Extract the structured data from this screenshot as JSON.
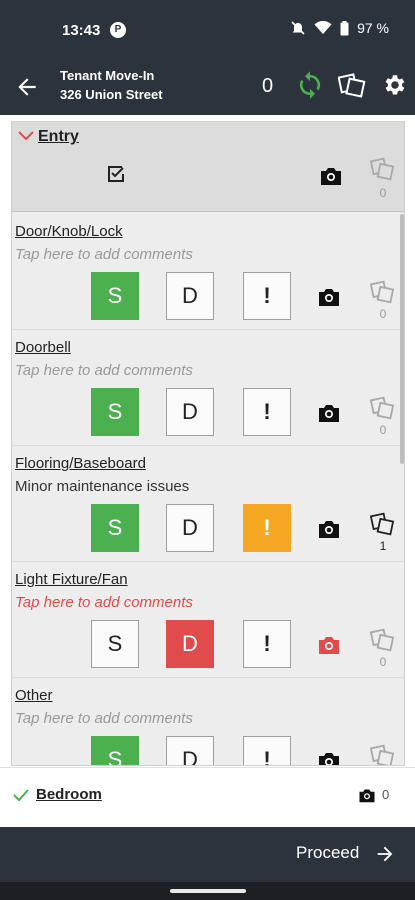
{
  "status": {
    "time": "13:43",
    "battery": "97 %",
    "app_badge": "P"
  },
  "header": {
    "title_line1": "Tenant Move-In",
    "title_line2": "326 Union Street",
    "pending_count": "0"
  },
  "section": {
    "title": "Entry",
    "photo_count": "0"
  },
  "items": [
    {
      "name": "Door/Knob/Lock",
      "comment": "Tap here to add comments",
      "s": "S",
      "d": "D",
      "x": "!",
      "photo_count": "0"
    },
    {
      "name": "Doorbell",
      "comment": "Tap here to add comments",
      "s": "S",
      "d": "D",
      "x": "!",
      "photo_count": "0"
    },
    {
      "name": "Flooring/Baseboard",
      "comment": "Minor maintenance issues",
      "s": "S",
      "d": "D",
      "x": "!",
      "photo_count": "1"
    },
    {
      "name": "Light Fixture/Fan",
      "comment": "Tap here to add comments",
      "s": "S",
      "d": "D",
      "x": "!",
      "photo_count": "0"
    },
    {
      "name": "Other",
      "comment": "Tap here to add comments",
      "s": "S",
      "d": "D",
      "x": "!",
      "photo_count": "0"
    }
  ],
  "next_section": {
    "title": "Bedroom",
    "photo_count": "0"
  },
  "footer": {
    "proceed_label": "Proceed"
  },
  "colors": {
    "bar": "#2b333d",
    "good": "#4caf50",
    "damaged": "#e04b4b",
    "attention": "#f5a623",
    "sync": "#4caf50"
  }
}
